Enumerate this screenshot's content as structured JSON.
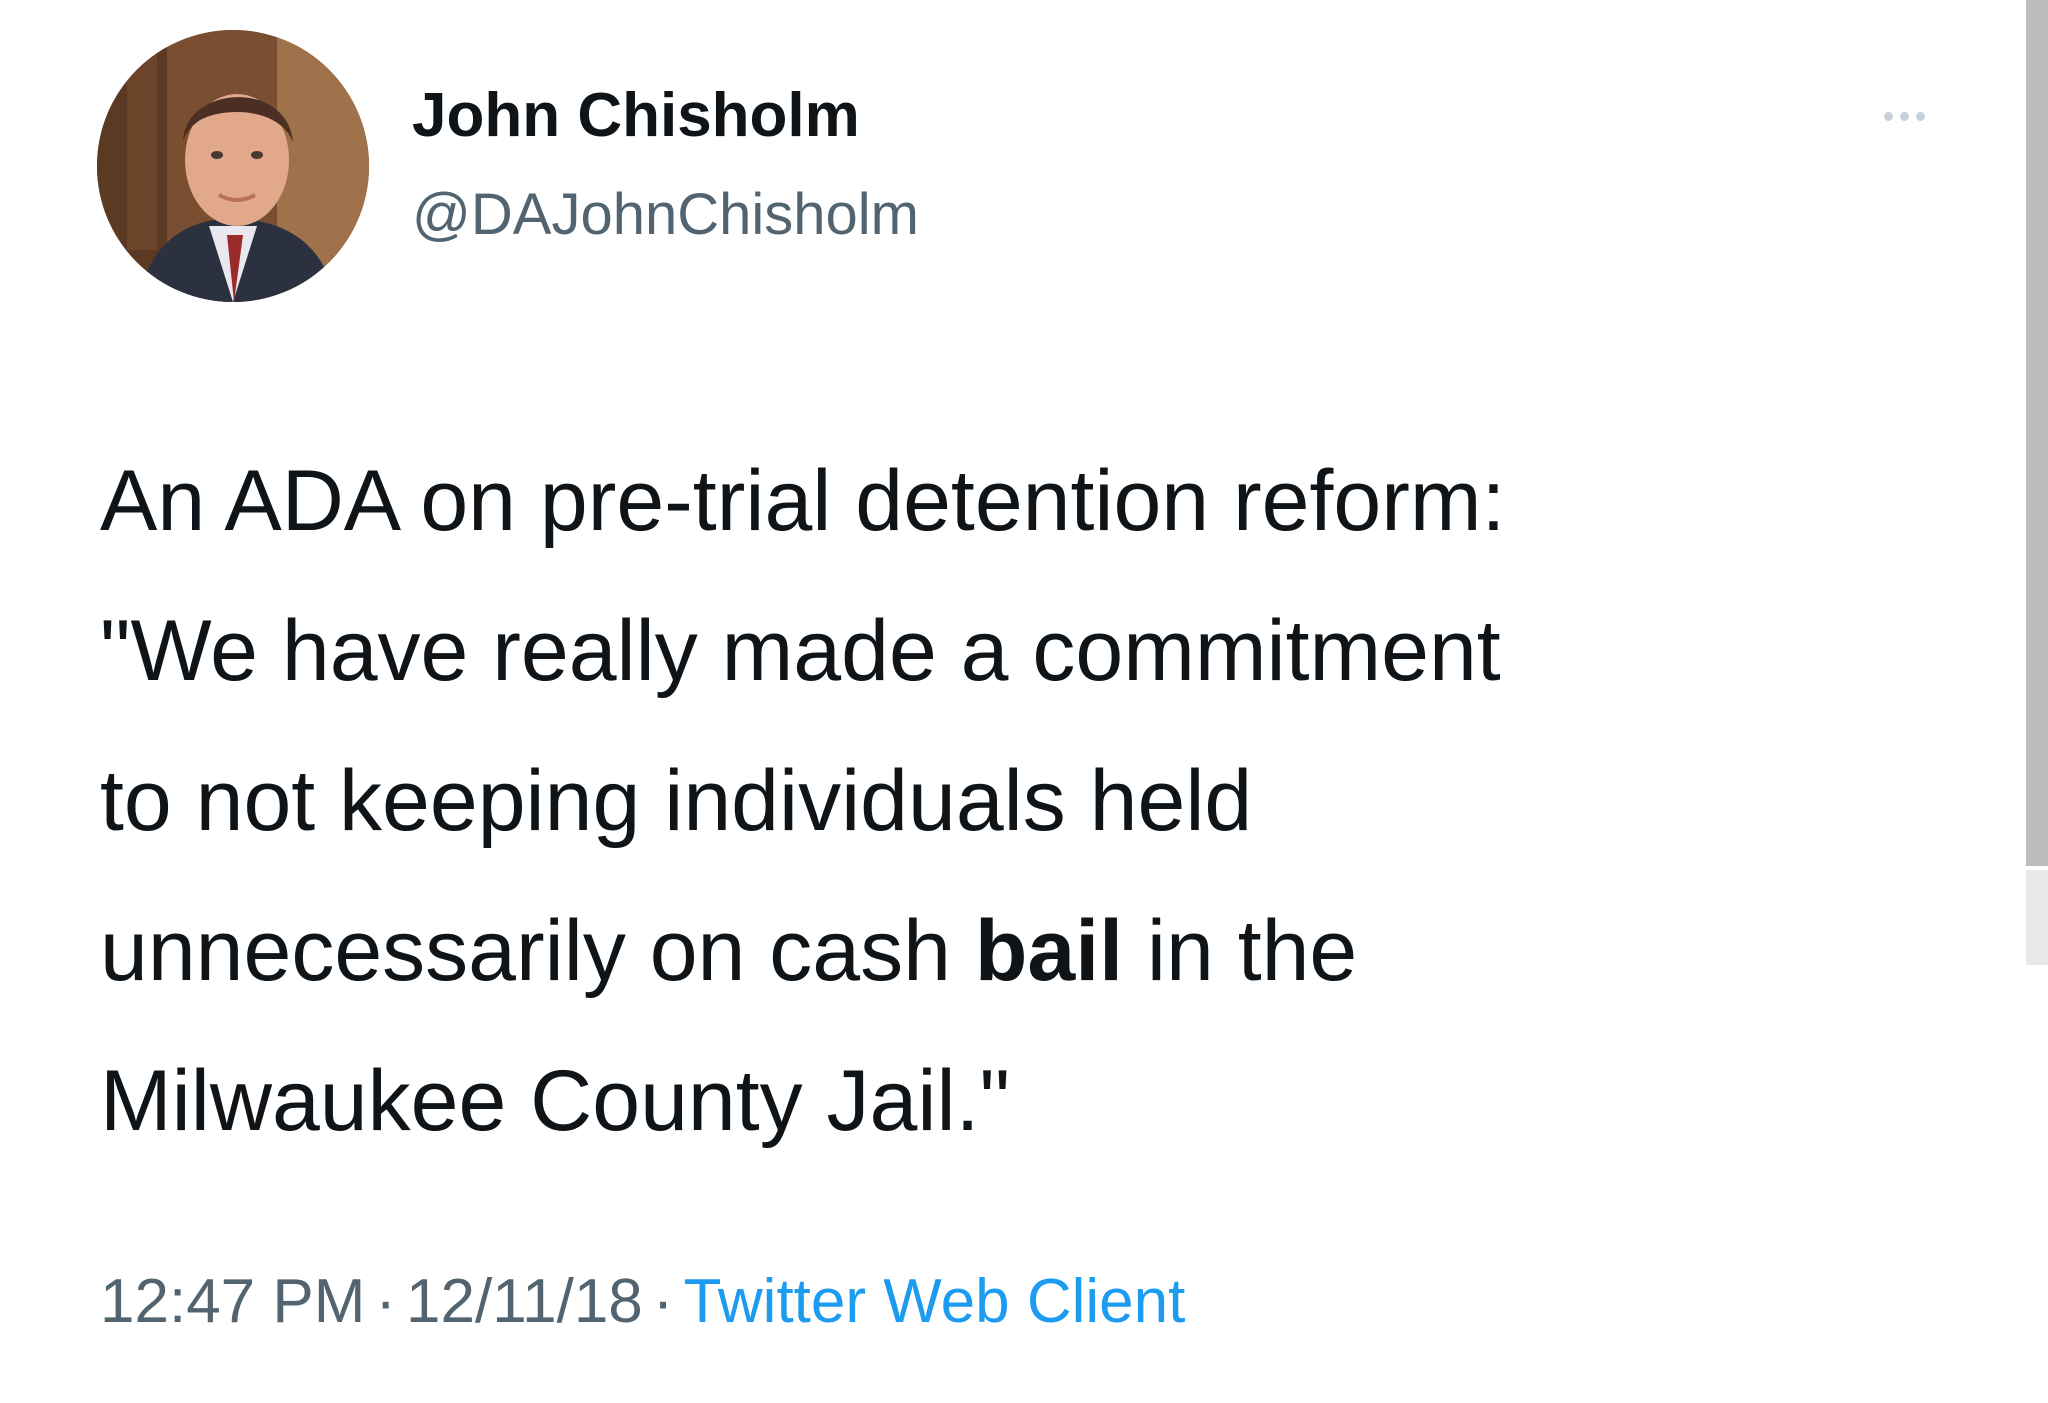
{
  "tweet": {
    "author": {
      "display_name": "John Chisholm",
      "handle": "@DAJohnChisholm"
    },
    "more_icon": "more-horizontal-icon",
    "text_lines": [
      {
        "before": "An ADA on pre-trial detention reform:",
        "bold": "",
        "after": ""
      },
      {
        "before": "\"We have really made a commitment",
        "bold": "",
        "after": ""
      },
      {
        "before": "to not keeping individuals held",
        "bold": "",
        "after": ""
      },
      {
        "before": "unnecessarily on cash ",
        "bold": "bail",
        "after": " in the"
      },
      {
        "before": "Milwaukee County Jail.\"",
        "bold": "",
        "after": ""
      }
    ],
    "time": "12:47 PM",
    "date": "12/11/18",
    "separator": "·",
    "client": "Twitter Web Client"
  },
  "colors": {
    "text": "#0f1419",
    "secondary": "#536471",
    "link": "#1d9bf0"
  }
}
